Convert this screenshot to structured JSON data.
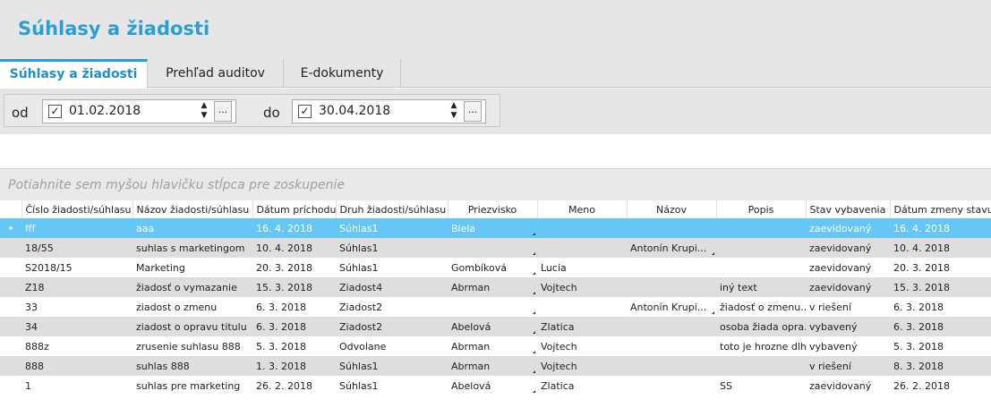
{
  "page": {
    "title": "Súhlasy a žiadosti"
  },
  "tabs": [
    {
      "label": "Súhlasy a žiadosti"
    },
    {
      "label": "Prehľad auditov"
    },
    {
      "label": "E-dokumenty"
    }
  ],
  "filter": {
    "from_label": "od",
    "from_value": "01.02.2018",
    "from_checked": true,
    "to_label": "do",
    "to_value": "30.04.2018",
    "to_checked": true,
    "ellipsis": "..."
  },
  "group_hint": "Potiahnite sem myšou hlavičku stĺpca pre zoskupenie",
  "grid": {
    "columns": [
      "Číslo žiadosti/súhlasu",
      "Názov žiadosti/súhlasu",
      "Dátum príchodu",
      "Druh žiadosti/súhlasu",
      "Priezvisko",
      "Meno",
      "Názov",
      "Popis",
      "Stav vybavenia",
      "Dátum zmeny stavu"
    ],
    "rows": [
      [
        "fff",
        "aaa",
        "16. 4. 2018",
        "Súhlas1",
        "Biela",
        "",
        "",
        "",
        "zaevidovaný",
        "16. 4. 2018"
      ],
      [
        "18/55",
        "suhlas s marketingom",
        "10. 4. 2018",
        "Súhlas1",
        "",
        "",
        "Antonín  Krupi...",
        "",
        "zaevidovaný",
        "10. 4. 2018"
      ],
      [
        "S2018/15",
        "Marketing",
        "20. 3. 2018",
        "Súhlas1",
        "Gombíková",
        "Lucia",
        "",
        "",
        "zaevidovaný",
        "20. 3. 2018"
      ],
      [
        "Z18",
        "žiadosť o vymazanie",
        "15. 3. 2018",
        "Ziadost4",
        "Abrman",
        "Vojtech",
        "",
        "iný text",
        "zaevidovaný",
        "15. 3. 2018"
      ],
      [
        "33",
        "ziadost o zmenu",
        "6. 3. 2018",
        "Ziadost2",
        "",
        "",
        "Antonín  Krupi...",
        "žiadosť o zmenu...",
        "v riešení",
        "6. 3. 2018"
      ],
      [
        "34",
        "ziadost o opravu titulu",
        "6. 3. 2018",
        "Ziadost2",
        "Abelová",
        "Zlatica",
        "",
        "osoba žiada opra...",
        "vybavený",
        "6. 3. 2018"
      ],
      [
        "888z",
        "zrusenie suhlasu 888",
        "5. 3. 2018",
        "Odvolane",
        "Abrman",
        "Vojtech",
        "",
        "toto je hrozne dlh...",
        "vybavený",
        "5. 3. 2018"
      ],
      [
        "888",
        "suhlas 888",
        "1. 3. 2018",
        "Súhlas1",
        "Abrman",
        "Vojtech",
        "",
        "",
        "v riešení",
        "8. 3. 2018"
      ],
      [
        "1",
        "suhlas pre marketing",
        "26. 2. 2018",
        "Súhlas1",
        "Abelová",
        "Zlatica",
        "",
        "SS",
        "zaevidovaný",
        "26. 2. 2018"
      ]
    ],
    "selected_row_marker": "•"
  },
  "colors": {
    "accent": "#2a9fd6",
    "selected_row": "#66c7f7",
    "alt_row": "#dedede"
  }
}
